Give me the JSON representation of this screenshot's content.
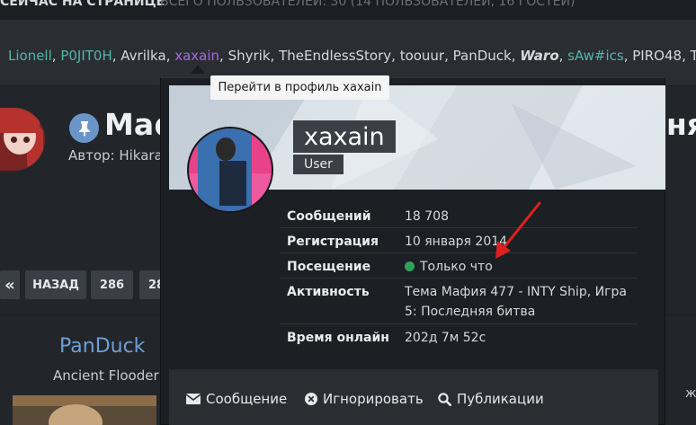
{
  "top_strip": {
    "title": "Сейчас на странице",
    "stats": "Всего пользователей: 30   (14 пользователей, 16 гостей)"
  },
  "online_users": [
    {
      "name": "Lionell",
      "style": "teal"
    },
    {
      "name": "P0JIT0H",
      "style": "teal"
    },
    {
      "name": "Avrilka",
      "style": "plain"
    },
    {
      "name": "xaxain",
      "style": "purple"
    },
    {
      "name": "Shyrik",
      "style": "plain"
    },
    {
      "name": "TheEndlessStory",
      "style": "plain"
    },
    {
      "name": "toouur",
      "style": "plain"
    },
    {
      "name": "PanDuck",
      "style": "plain"
    },
    {
      "name": "Waro",
      "style": "bold"
    },
    {
      "name": "sAw#ics",
      "style": "teal"
    },
    {
      "name": "PIRO48",
      "style": "plain"
    },
    {
      "name": "T",
      "style": "plain"
    }
  ],
  "tooltip": "Перейти в профиль xaxain",
  "topic": {
    "title_start": "Маф",
    "title_end": "ня",
    "author": "Автор: Hikara"
  },
  "pagination": {
    "first": "«",
    "back": "НАЗАД",
    "page_a": "286",
    "page_b": "28"
  },
  "post": {
    "username": "PanDuck",
    "rank": "Ancient Flooder",
    "cut_text": "жмо"
  },
  "profile": {
    "username": "xaxain",
    "role": "User",
    "rows": [
      {
        "label": "Сообщений",
        "value": "18 708"
      },
      {
        "label": "Регистрация",
        "value": "10 января 2014"
      },
      {
        "label": "Посещение",
        "value": "Только что"
      },
      {
        "label": "Активность",
        "value": "Тема Мафия 477 - INTY Ship, Игра 5: Последняя битва"
      },
      {
        "label": "Время онлайн",
        "value": "202д 7м 52с"
      }
    ],
    "online_color": "#2fa35c",
    "actions": {
      "message": "Сообщение",
      "ignore": "Игнорировать",
      "posts": "Публикации"
    }
  },
  "colors": {
    "accent_blue": "#6d9fd6",
    "teal_user": "#4fb8a8",
    "purple_user": "#a36ae0",
    "annotation_arrow": "#e02020"
  }
}
